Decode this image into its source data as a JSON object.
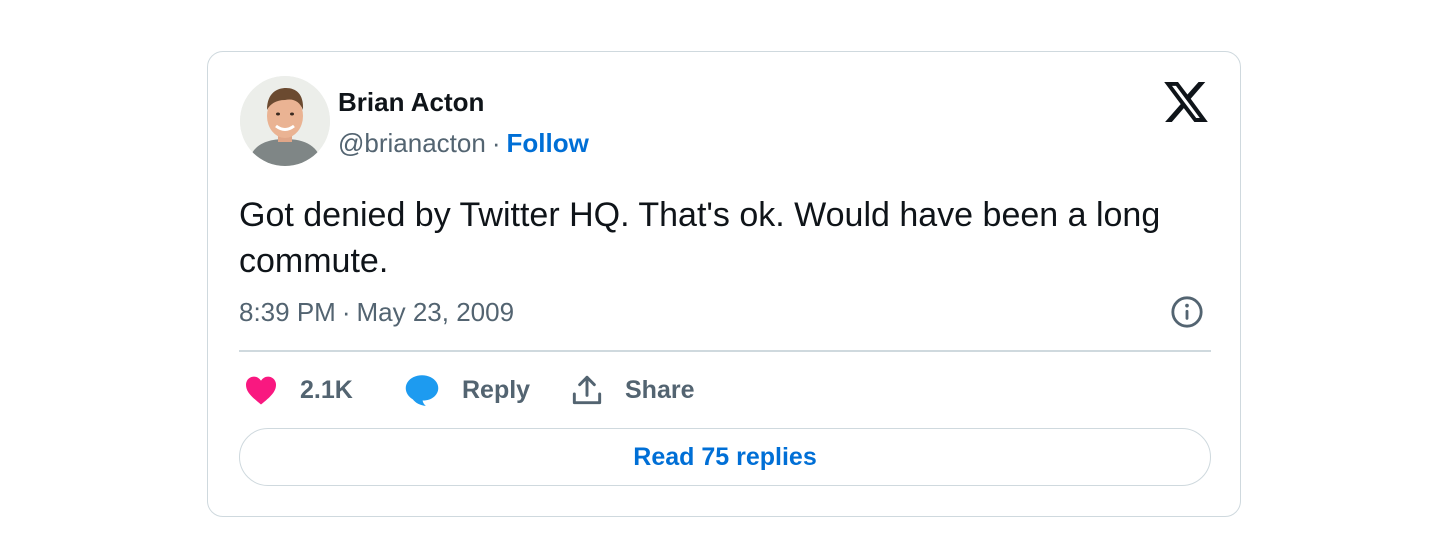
{
  "author": {
    "name": "Brian Acton",
    "handle": "@brianacton",
    "separator": "·",
    "follow_label": "Follow"
  },
  "tweet": {
    "text": "Got denied by Twitter HQ. That's ok. Would have been a long commute.",
    "time": "8:39 PM",
    "separator": "·",
    "date": "May 23, 2009"
  },
  "actions": {
    "like_count": "2.1K",
    "reply_label": "Reply",
    "share_label": "Share",
    "read_replies_label": "Read 75 replies"
  },
  "icons": {
    "logo": "x-logo-icon",
    "info": "info-icon",
    "like": "heart-icon",
    "reply": "speech-bubble-icon",
    "share": "share-upload-icon"
  },
  "colors": {
    "like": "#f91880",
    "reply": "#1d9bf0",
    "link": "#006fd6",
    "muted": "#536471",
    "border": "#cfd9de",
    "text": "#0f1419"
  }
}
